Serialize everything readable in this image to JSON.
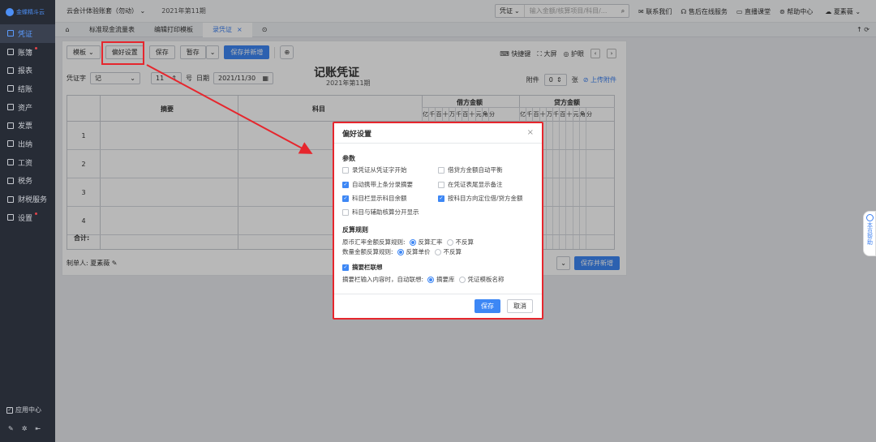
{
  "sidebar": {
    "logo": "金蝶精斗云",
    "items": [
      {
        "label": "凭证",
        "active": true,
        "dot": false
      },
      {
        "label": "账簿",
        "active": false,
        "dot": true
      },
      {
        "label": "报表",
        "active": false,
        "dot": false
      },
      {
        "label": "结账",
        "active": false,
        "dot": false
      },
      {
        "label": "资产",
        "active": false,
        "dot": false
      },
      {
        "label": "发票",
        "active": false,
        "dot": false
      },
      {
        "label": "出纳",
        "active": false,
        "dot": false
      },
      {
        "label": "工资",
        "active": false,
        "dot": false
      },
      {
        "label": "税务",
        "active": false,
        "dot": false
      },
      {
        "label": "财税服务",
        "active": false,
        "dot": false
      },
      {
        "label": "设置",
        "active": false,
        "dot": true
      }
    ],
    "app_center": "应用中心"
  },
  "topbar": {
    "account": "云会计体验账套（勿动）",
    "period": "2021年第11期",
    "search_select": "凭证",
    "search_placeholder": "输入金额/核算项目/科目/...",
    "links": [
      "联系我们",
      "售后在线服务",
      "直播课堂",
      "帮助中心"
    ],
    "user": "夏素薇"
  },
  "tabs": [
    {
      "label": "标准现金流量表",
      "active": false
    },
    {
      "label": "编辑打印模板",
      "active": false
    },
    {
      "label": "录凭证",
      "active": true
    }
  ],
  "toolbar": {
    "template": "模板",
    "preference": "偏好设置",
    "save": "保存",
    "draft": "暂存",
    "save_new": "保存并新增",
    "shortcut": "快捷键",
    "fullscreen": "大屏",
    "eye": "护眼"
  },
  "voucher": {
    "title": "记账凭证",
    "subtitle": "2021年第11期",
    "word_label": "凭证字",
    "word_value": "记",
    "number_value": "11",
    "number_suffix": "号",
    "date_label": "日期",
    "date_value": "2021/11/30",
    "attach_label": "附件",
    "attach_value": "0",
    "attach_unit": "张",
    "upload": "上传附件",
    "col_summary": "摘要",
    "col_subject": "科目",
    "col_debit": "借方金额",
    "col_credit": "贷方金额",
    "digits": [
      "亿",
      "千",
      "百",
      "十",
      "万",
      "千",
      "百",
      "十",
      "元",
      "角",
      "分"
    ],
    "rows": [
      "1",
      "2",
      "3",
      "4"
    ],
    "total": "合计:",
    "maker_label": "制单人:",
    "maker_name": "夏素薇",
    "bottom_save_new": "保存并新增"
  },
  "dialog": {
    "title": "偏好设置",
    "sec_params": "参数",
    "params": [
      {
        "label": "录凭证从凭证字开始",
        "checked": false
      },
      {
        "label": "借贷方金额自动平衡",
        "checked": false
      },
      {
        "label": "自动携带上条分录摘要",
        "checked": true
      },
      {
        "label": "在凭证表尾显示备注",
        "checked": false
      },
      {
        "label": "科目栏显示科目余额",
        "checked": true
      },
      {
        "label": "按科目方向定位借/贷方金额",
        "checked": true
      },
      {
        "label": "科目与辅助核算分开显示",
        "checked": false
      }
    ],
    "sec_calc": "反算规则",
    "rule1_label": "原币汇率金额反算规则:",
    "rule1_opt1": "反算汇率",
    "rule1_opt2": "不反算",
    "rule2_label": "数量金额反算规则:",
    "rule2_opt1": "反算单价",
    "rule2_opt2": "不反算",
    "sec_assoc": "摘要栏联想",
    "assoc_label": "摘要栏输入内容时，自动联想:",
    "assoc_opt1": "摘要库",
    "assoc_opt2": "凭证模板名称",
    "save": "保存",
    "cancel": "取消"
  },
  "help_tab": "本页帮助",
  "colors": {
    "accent": "#3d87f5",
    "highlight": "#e6262d",
    "sidebar": "#272c36"
  }
}
